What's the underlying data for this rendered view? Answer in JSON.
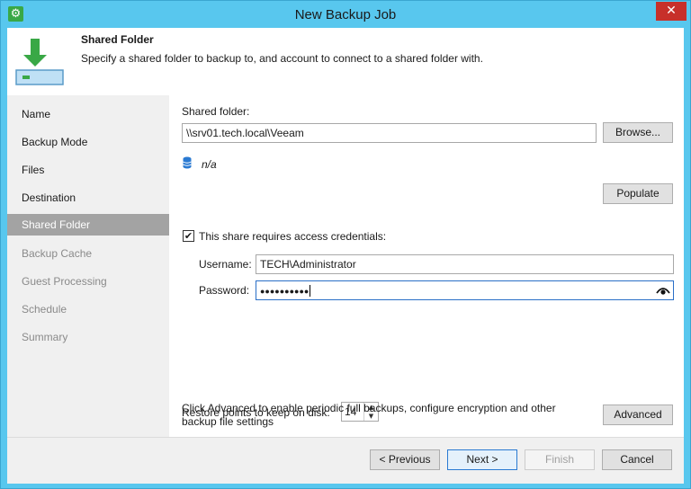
{
  "window": {
    "title": "New Backup Job",
    "app_icon": "gear-icon",
    "close_glyph": "✕"
  },
  "header": {
    "title": "Shared Folder",
    "description": "Specify a shared folder to backup to, and account to connect to a shared folder with.",
    "icon": "download-to-drive-icon"
  },
  "sidebar": {
    "steps": [
      {
        "label": "Name",
        "state": "done"
      },
      {
        "label": "Backup Mode",
        "state": "done"
      },
      {
        "label": "Files",
        "state": "done"
      },
      {
        "label": "Destination",
        "state": "done"
      },
      {
        "label": "Shared Folder",
        "state": "active"
      },
      {
        "label": "Backup Cache",
        "state": "todo"
      },
      {
        "label": "Guest Processing",
        "state": "todo"
      },
      {
        "label": "Schedule",
        "state": "todo"
      },
      {
        "label": "Summary",
        "state": "todo"
      }
    ]
  },
  "content": {
    "shared_folder_label": "Shared folder:",
    "shared_folder_value": "\\\\srv01.tech.local\\Veeam",
    "browse_label": "Browse...",
    "capacity_text": "n/a",
    "populate_label": "Populate",
    "credentials_checkbox_label": "This share requires access credentials:",
    "credentials_checked": true,
    "check_glyph": "✔",
    "username_label": "Username:",
    "username_value": "TECH\\Administrator",
    "password_label": "Password:",
    "password_value": "●●●●●●●●●●",
    "restore_points_label": "Restore points to keep on disk:",
    "restore_points_value": "14",
    "spin_up_glyph": "▲",
    "spin_down_glyph": "▼",
    "advanced_text_line1": "Click Advanced to enable periodic full backups, configure encryption and other",
    "advanced_text_line2": "backup file settings",
    "advanced_label": "Advanced"
  },
  "footer": {
    "previous_label": "< Previous",
    "next_label": "Next >",
    "finish_label": "Finish",
    "cancel_label": "Cancel"
  },
  "colors": {
    "titlebar": "#58c7ee",
    "close": "#c7302a",
    "active_step": "#a3a3a3",
    "accent_green": "#39a846"
  }
}
